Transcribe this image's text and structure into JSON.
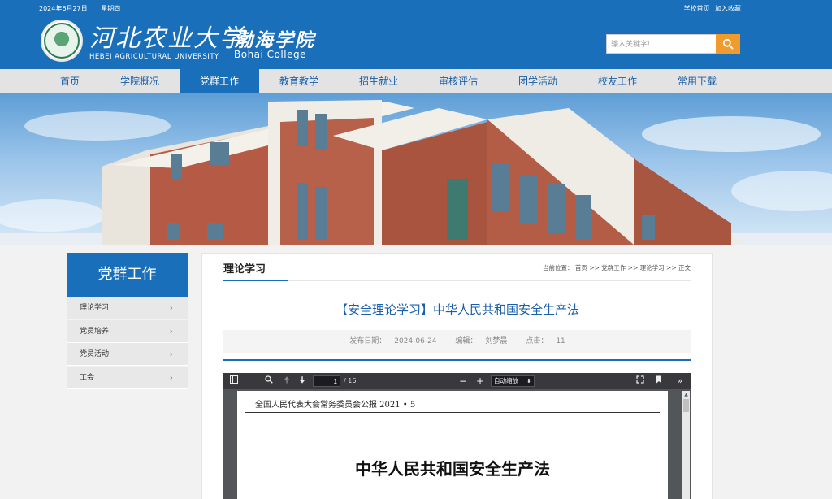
{
  "topbar": {
    "date": "2024年6月27日",
    "weekday": "星期四",
    "home_link": "学校首页",
    "favorite_link": "加入收藏"
  },
  "logo": {
    "university_cn": "河北农业大学",
    "university_en": "HEBEI AGRICULTURAL UNIVERSITY",
    "college_cn": "渤海学院",
    "college_en": "Bohai College"
  },
  "search": {
    "placeholder": "输入关键字!",
    "icon": "search-icon"
  },
  "nav": {
    "items": [
      "首页",
      "学院概况",
      "党群工作",
      "教育教学",
      "招生就业",
      "审核评估",
      "团学活动",
      "校友工作",
      "常用下载"
    ],
    "active": "党群工作"
  },
  "sidebar": {
    "title": "党群工作",
    "items": [
      "理论学习",
      "党员培养",
      "党员活动",
      "工会"
    ]
  },
  "main": {
    "section_title": "理论学习",
    "breadcrumb": {
      "prefix": "当前位置：",
      "items": [
        "首页",
        "党群工作",
        "理论学习",
        "正文"
      ],
      "separator": ">>"
    },
    "article_title": "【安全理论学习】中华人民共和国安全生产法",
    "meta": {
      "date_label": "发布日期：",
      "date": "2024-06-24",
      "editor_label": "编辑：",
      "editor": "刘梦晨",
      "views_label": "点击：",
      "views": "11"
    }
  },
  "pdf": {
    "page_current": "1",
    "page_total": "/ 16",
    "zoom": "自动缩放",
    "doc_header": "全国人民代表大会常务委员会公报 2021 • 5",
    "doc_title": "中华人民共和国安全生产法"
  },
  "colors": {
    "primary": "#1a6fba",
    "accent": "#f19b2c",
    "nav_bg": "#e3e3e3",
    "link": "#1a5fa8"
  }
}
